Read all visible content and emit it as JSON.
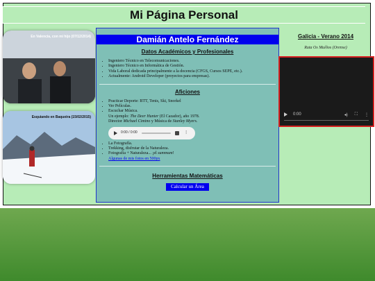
{
  "header": {
    "title": "Mi Página Personal"
  },
  "photos": [
    {
      "caption": "En Valencia, con mi hijo (07/12/2014)"
    },
    {
      "caption": "Esquiando en Baqueira (15/02/2015)"
    }
  ],
  "profile": {
    "name": "Damián Antelo Fernández",
    "academic": {
      "title": "Datos Académicos y Profesionales",
      "items": [
        "Ingeniero Técnico en Telecomunicaciones.",
        "Ingeniero Técnico en Informática de Gestión.",
        "Vida Laboral dedicada principalmente a la docencia (CFGS, Cursos SEPE, etc.).",
        "Actualmente: Android Developer (proyectos para empresas)."
      ]
    },
    "hobbies": {
      "title": "Aficiones",
      "items": [
        "Practicar Deporte: BTT, Tenis, Ski, Snorkel",
        "Ver Películas.",
        "Escuchar Música."
      ],
      "music_example": {
        "prefix": "Un ejemplo: ",
        "film": "The Deer Hunter",
        "mid": " (El Cazador), año 1978.",
        "director_prefix": "Director ",
        "director": "Michael Cimino",
        "music_prefix": " y Música de ",
        "composer": "Stanley Myers",
        "suffix": "."
      },
      "audio": {
        "time": "0:00 / 0:00",
        "more": "⋮"
      },
      "items2": [
        "La Fotografía.",
        "Trekking, disfrutar de la Naturaleza."
      ],
      "photo_item": {
        "text": "Fotografía + Naturaleza... ¡el ",
        "emph": "summum",
        "end": "!"
      },
      "photos_link": "Algunas de mis fotos en 500px"
    },
    "math": {
      "title": "Herramientas Matemáticas",
      "button": "Calcular un Área"
    }
  },
  "right": {
    "title": "Galicia - Verano 2014",
    "subtitle": "Ruta Os Muíños (Orense)",
    "video": {
      "time": "0:00",
      "play_icon": "play-icon",
      "volume_icon": "volume-icon",
      "fullscreen_icon": "fullscreen-icon",
      "more_icon": "more-icon"
    }
  },
  "colors": {
    "page_bg": "#b7ecb7",
    "center_bg": "#7fbfb6",
    "name_bar": "#0000ee",
    "video_border": "#d61f1f"
  }
}
